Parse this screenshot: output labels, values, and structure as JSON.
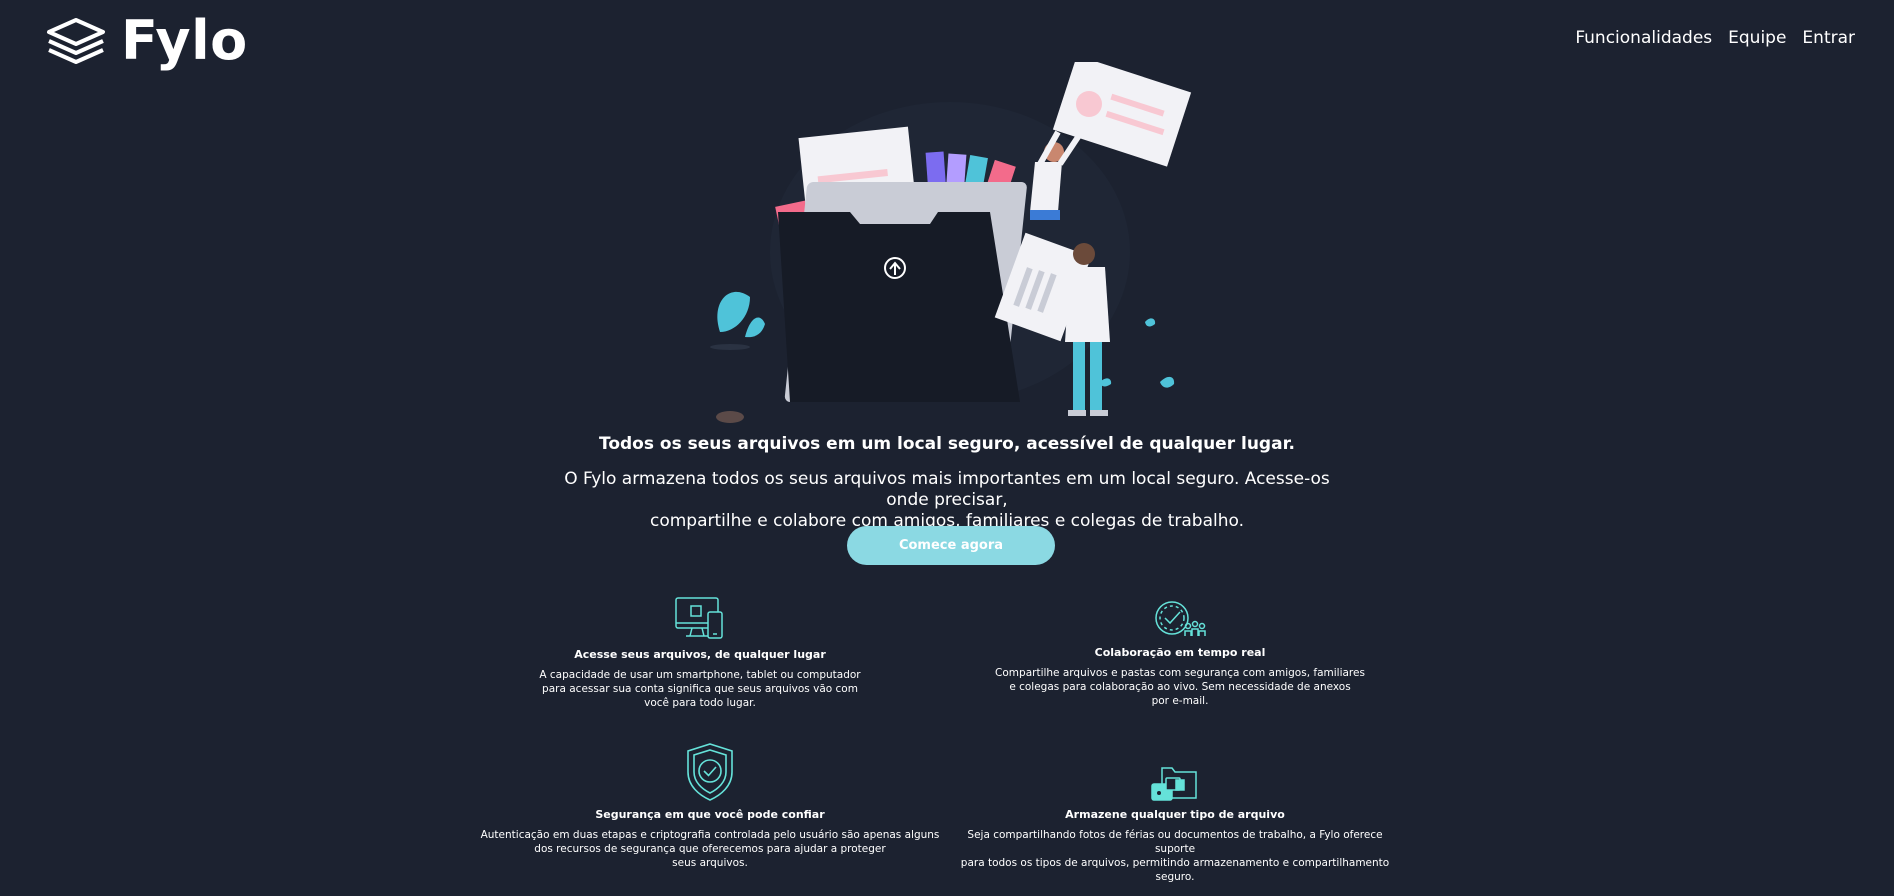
{
  "brand": {
    "name": "Fylo",
    "logo_icon": "stacked-layers-icon"
  },
  "nav": {
    "items": [
      {
        "label": "Funcionalidades"
      },
      {
        "label": "Equipe"
      },
      {
        "label": "Entrar"
      }
    ]
  },
  "hero": {
    "illustration": "file-folder-with-people-illustration",
    "title": "Todos os seus arquivos em um local seguro, acessível de qualquer lugar.",
    "text_line1": "O Fylo armazena todos os seus arquivos mais importantes em um local seguro. Acesse-os onde precisar,",
    "text_line2": "compartilhe e colabore com amigos, familiares e colegas de trabalho.",
    "cta_label": "Comece agora"
  },
  "features": [
    {
      "icon": "devices-icon",
      "title": "Acesse seus arquivos, de qualquer lugar",
      "line1": "A capacidade de usar um smartphone, tablet ou computador",
      "line2": "para acessar sua conta significa que seus arquivos vão com",
      "line3": "você para todo lugar."
    },
    {
      "icon": "collaboration-clock-icon",
      "title": "Colaboração em tempo real",
      "line1": "Compartilhe arquivos e pastas com segurança com amigos, familiares",
      "line2": "e colegas para colaboração ao vivo. Sem necessidade de anexos",
      "line3": "por e-mail."
    },
    {
      "icon": "shield-check-icon",
      "title": "Segurança em que você pode confiar",
      "line1": "Autenticação em duas etapas e criptografia controlada pelo usuário são apenas alguns",
      "line2": "dos recursos de segurança que oferecemos para ajudar a proteger",
      "line3": "seus arquivos."
    },
    {
      "icon": "file-types-icon",
      "title": "Armazene qualquer tipo de arquivo",
      "line1": "Seja compartilhando fotos de férias ou documentos de trabalho, a Fylo oferece suporte",
      "line2": "para todos os tipos de arquivos, permitindo armazenamento e compartilhamento",
      "line3": "seguro."
    }
  ],
  "colors": {
    "background": "#1c2230",
    "accent": "#65e2d9",
    "cta": "#8bd9e3",
    "text": "#ffffff"
  }
}
